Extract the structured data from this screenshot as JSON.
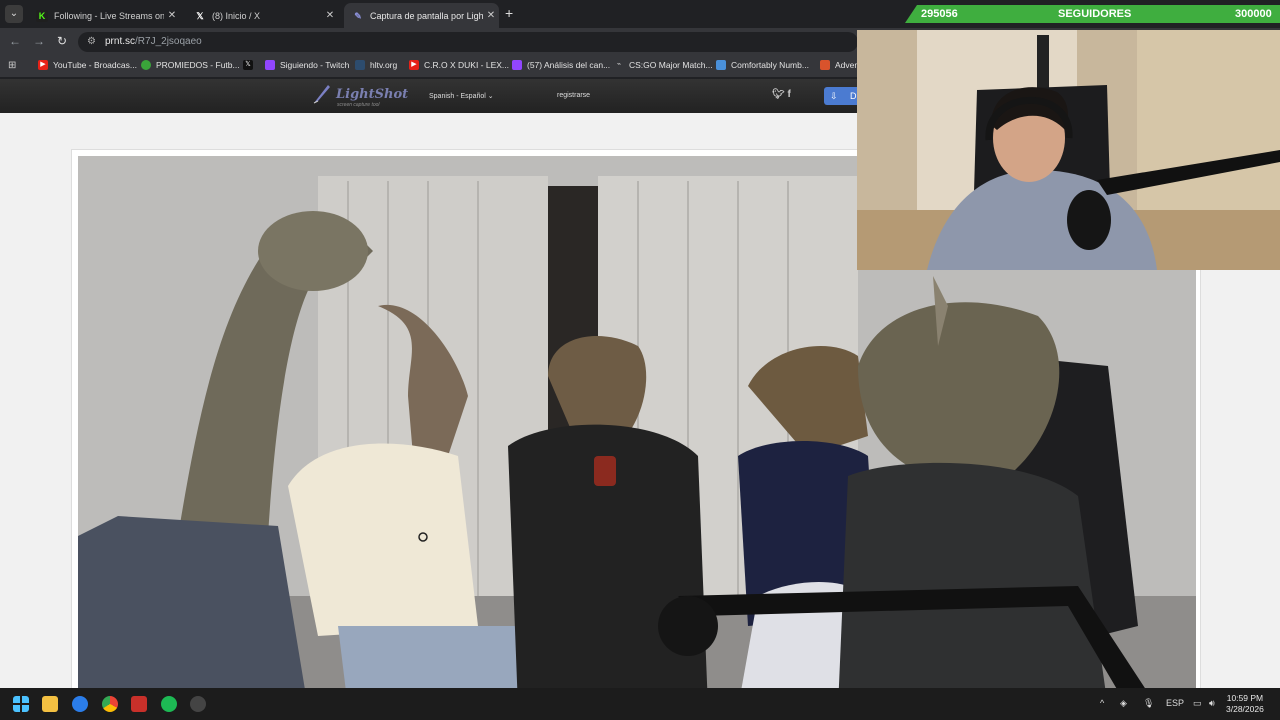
{
  "browser": {
    "tabs": [
      {
        "title": "Following - Live Streams on Kic",
        "icon": "kick-icon"
      },
      {
        "title": "(8) Inicio / X",
        "icon": "x-logo-icon"
      },
      {
        "title": "Captura de pantalla por Lightsh",
        "icon": "lightshot-icon",
        "active": true
      }
    ],
    "url_domain": "prnt.sc",
    "url_path": "/R7J_2jsoqaeo",
    "bookmarks": [
      {
        "label": "YouTube - Broadcas...",
        "icon": "youtube-icon"
      },
      {
        "label": "PROMIEDOS - Futb...",
        "icon": "promiedos-icon"
      },
      {
        "label": "",
        "icon": "x-logo-icon"
      },
      {
        "label": "Siguiendo - Twitch",
        "icon": "twitch-icon"
      },
      {
        "label": "hltv.org",
        "icon": "hltv-icon"
      },
      {
        "label": "C.R.O X DUKI - LEX...",
        "icon": "youtube-icon"
      },
      {
        "label": "(57) Análisis del can...",
        "icon": "twitch-icon"
      },
      {
        "label": "CS:GO Major Match...",
        "icon": "link-icon"
      },
      {
        "label": "Comfortably Numb...",
        "icon": "bookmark-icon"
      },
      {
        "label": "Adven",
        "icon": "bookmark-icon"
      }
    ]
  },
  "stream_overlay": {
    "goal_current": "295056",
    "goal_label": "SEGUIDORES",
    "goal_target": "300000",
    "goal_progress": 0.98
  },
  "lightshot": {
    "logo_text": "LightShot",
    "tagline": "screen capture tool",
    "language": "Spanish - Español",
    "register": "registrarse",
    "download_label": "D"
  },
  "taskbar": {
    "language": "ESP",
    "time": "10:59 PM",
    "date": "3/28/2026"
  },
  "colors": {
    "goal_green": "#3fae3f",
    "chrome_dark": "#202124",
    "chrome_toolbar": "#35363a",
    "lightshot_header": "#2a2a2a"
  }
}
